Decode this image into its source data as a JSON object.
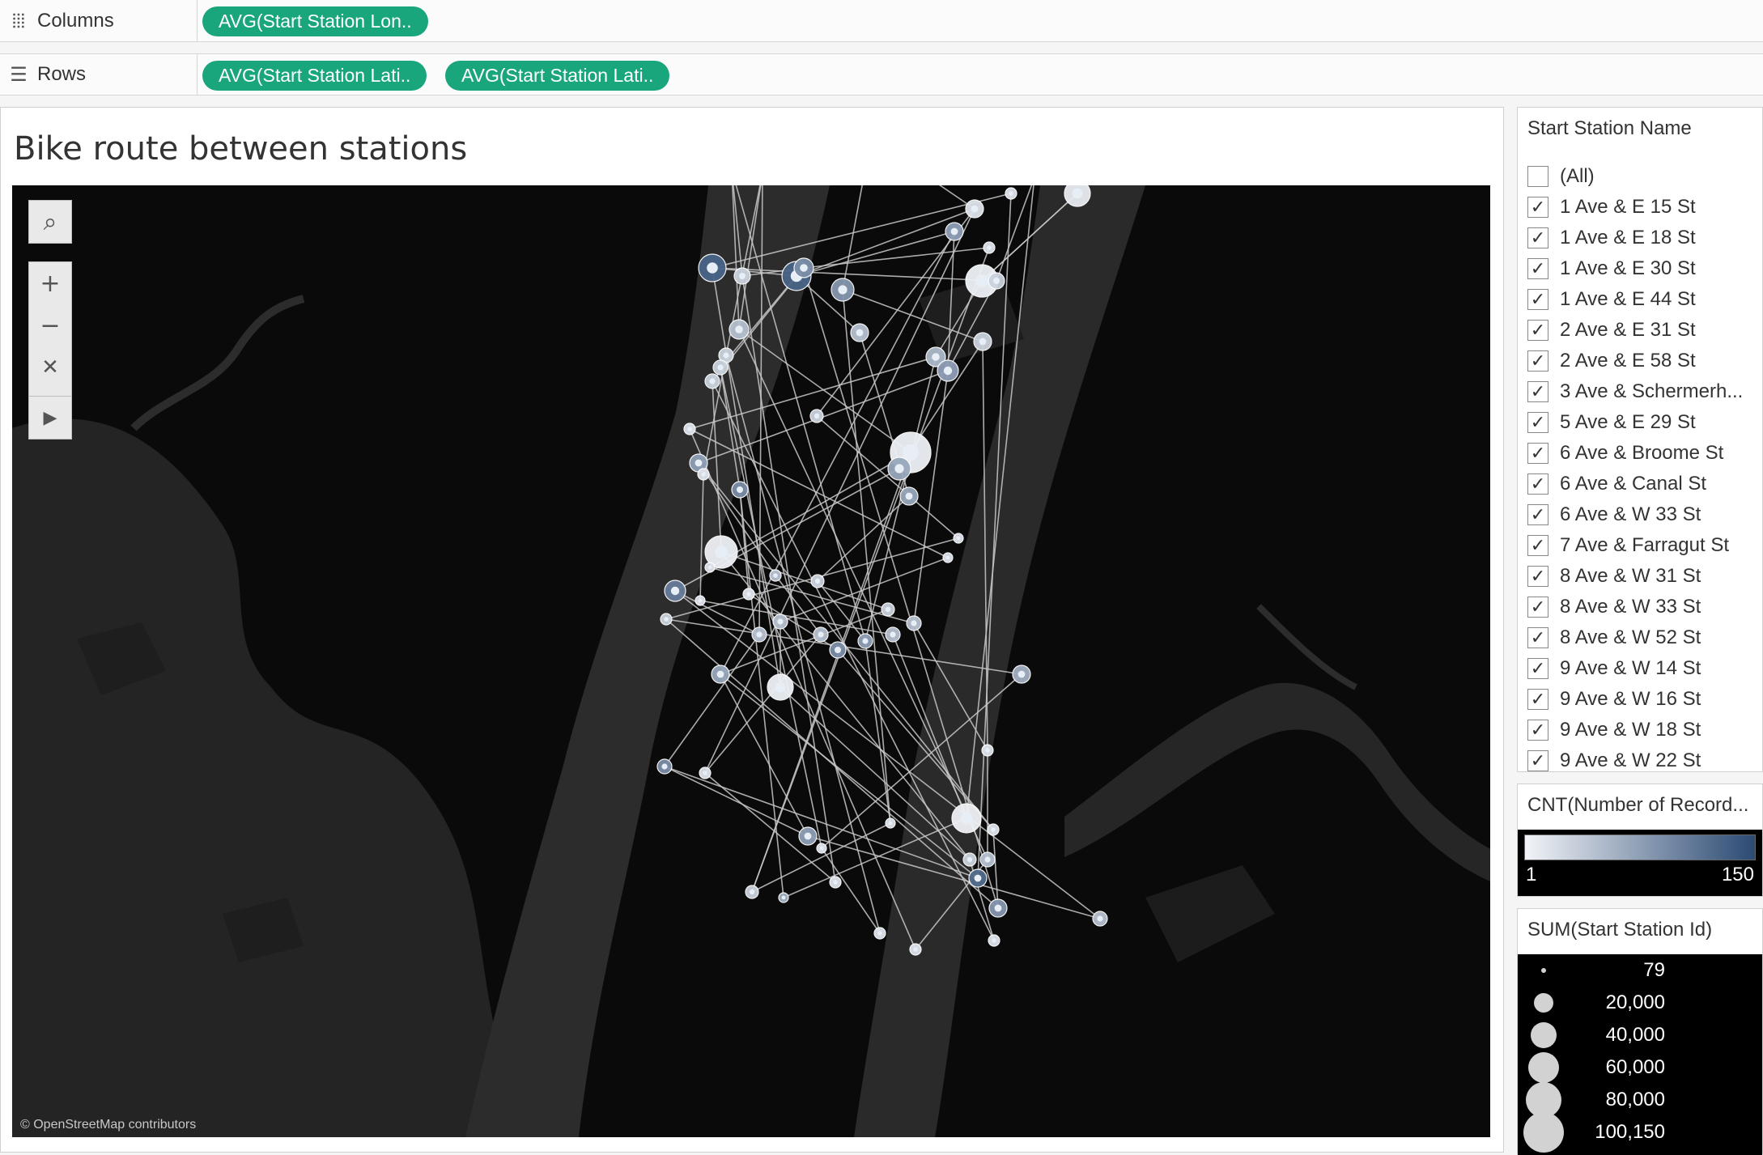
{
  "shelves": {
    "columns": {
      "label": "Columns",
      "icon": "columns-icon",
      "pills": [
        "AVG(Start Station Lon.."
      ]
    },
    "rows": {
      "label": "Rows",
      "icon": "rows-icon",
      "pills": [
        "AVG(Start Station Lati..",
        "AVG(Start Station Lati.."
      ]
    }
  },
  "viz": {
    "title": "Bike route between stations",
    "attribution": "© OpenStreetMap contributors",
    "tools": [
      "search-icon",
      "zoom-in-icon",
      "zoom-out-icon",
      "pin-clear-icon",
      "play-icon"
    ]
  },
  "filter": {
    "title": "Start Station Name",
    "items": [
      {
        "label": "(All)",
        "checked": false
      },
      {
        "label": "1 Ave & E 15 St",
        "checked": true
      },
      {
        "label": "1 Ave & E 18 St",
        "checked": true
      },
      {
        "label": "1 Ave & E 30 St",
        "checked": true
      },
      {
        "label": "1 Ave & E 44 St",
        "checked": true
      },
      {
        "label": "2 Ave & E 31 St",
        "checked": true
      },
      {
        "label": "2 Ave & E 58 St",
        "checked": true
      },
      {
        "label": "3 Ave & Schermerh...",
        "checked": true
      },
      {
        "label": "5 Ave & E 29 St",
        "checked": true
      },
      {
        "label": "6 Ave & Broome St",
        "checked": true
      },
      {
        "label": "6 Ave & Canal St",
        "checked": true
      },
      {
        "label": "6 Ave & W 33 St",
        "checked": true
      },
      {
        "label": "7 Ave & Farragut St",
        "checked": true
      },
      {
        "label": "8 Ave & W 31 St",
        "checked": true
      },
      {
        "label": "8 Ave & W 33 St",
        "checked": true
      },
      {
        "label": "8 Ave & W 52 St",
        "checked": true
      },
      {
        "label": "9 Ave & W 14 St",
        "checked": true
      },
      {
        "label": "9 Ave & W 16 St",
        "checked": true
      },
      {
        "label": "9 Ave & W 18 St",
        "checked": true
      },
      {
        "label": "9 Ave & W 22 St",
        "checked": true
      }
    ]
  },
  "color_legend": {
    "title": "CNT(Number of Record...",
    "min": "1",
    "max": "150",
    "color_low": "#f2f4f8",
    "color_high": "#2b4a73"
  },
  "size_legend": {
    "title": "SUM(Start Station Id)",
    "entries": [
      "79",
      "20,000",
      "40,000",
      "60,000",
      "80,000",
      "100,150"
    ]
  },
  "colors": {
    "pill": "#1aa67c",
    "map_bg": "#0a0a0a",
    "route_line": "#c8c8c8"
  }
}
